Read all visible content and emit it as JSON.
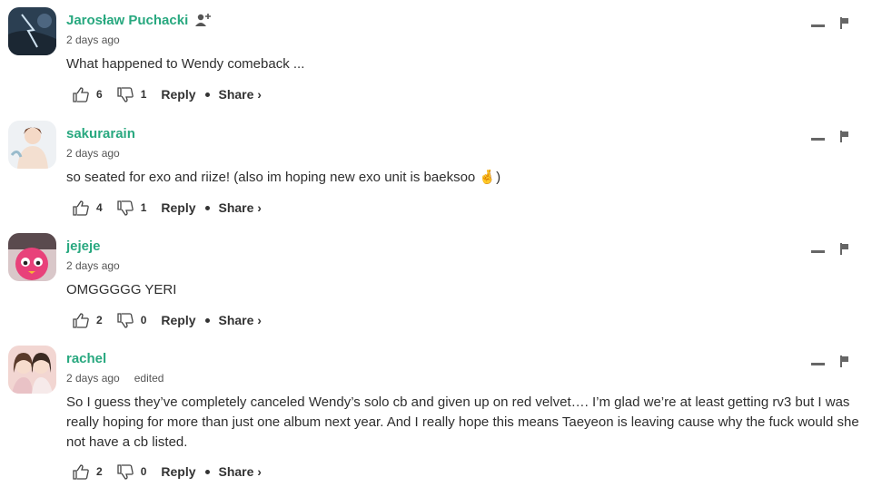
{
  "comments": [
    {
      "author": "Jarosław Puchacki",
      "show_follow": true,
      "time": "2 days ago",
      "edited": "",
      "text": "What happened to Wendy comeback ...",
      "likes": "6",
      "dislikes": "1",
      "reply_label": "Reply",
      "share_label": "Share ›"
    },
    {
      "author": "sakurarain",
      "show_follow": false,
      "time": "2 days ago",
      "edited": "",
      "text": "so seated for exo and riize! (also im hoping new exo unit is baeksoo 🤞)",
      "likes": "4",
      "dislikes": "1",
      "reply_label": "Reply",
      "share_label": "Share ›"
    },
    {
      "author": "jejeje",
      "show_follow": false,
      "time": "2 days ago",
      "edited": "",
      "text": "OMGGGGG YERI",
      "likes": "2",
      "dislikes": "0",
      "reply_label": "Reply",
      "share_label": "Share ›"
    },
    {
      "author": "rachel",
      "show_follow": false,
      "time": "2 days ago",
      "edited": "edited",
      "text": "So I guess they’ve completely canceled Wendy’s solo cb and given up on red velvet…. I’m glad we’re at least getting rv3 but I was really hoping for more than just one album next year. And I really hope this means Taeyeon is leaving cause why the fuck would she not have a cb listed.",
      "likes": "2",
      "dislikes": "0",
      "reply_label": "Reply",
      "share_label": "Share ›"
    }
  ],
  "colors": {
    "author": "#28a87f",
    "text": "#2e2e2e"
  },
  "icons": [
    "follow-user-icon",
    "thumbs-up-icon",
    "thumbs-down-icon",
    "collapse-icon",
    "flag-icon"
  ]
}
